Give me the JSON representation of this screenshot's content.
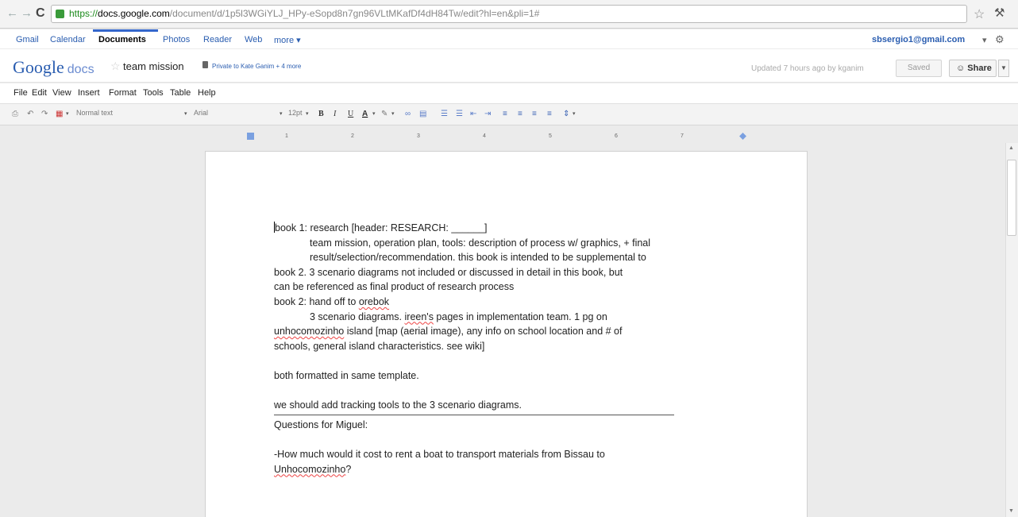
{
  "browser": {
    "url_https": "https://",
    "url_host": "docs.google.com",
    "url_path": "/document/d/1p5l3WGiYLJ_HPy-eSopd8n7gn96VLtMKafDf4dH84Tw/edit?hl=en&pli=1#"
  },
  "gbar": {
    "links": [
      "Gmail",
      "Calendar",
      "Documents",
      "Photos",
      "Reader",
      "Web",
      "more ▾"
    ],
    "account": "sbsergio1@gmail.com"
  },
  "header": {
    "logo": "Google",
    "logo_suffix": "docs",
    "title": "team mission",
    "privacy": "Private to Kate Ganim + 4 more",
    "updated": "Updated 7 hours ago by kganim",
    "saved": "Saved",
    "share": "Share"
  },
  "menu": [
    "File",
    "Edit",
    "View",
    "Insert",
    "Format",
    "Tools",
    "Table",
    "Help"
  ],
  "toolbar": {
    "style": "Normal text",
    "font": "Arial",
    "size": "12pt",
    "bold": "B",
    "italic": "I",
    "underline": "U",
    "text_color": "A"
  },
  "ruler_numbers": [
    "1",
    "2",
    "3",
    "4",
    "5",
    "6",
    "7"
  ],
  "document": {
    "l1": "book 1: research [header:  RESEARCH: ______]",
    "l2": "team mission, operation plan, tools: description of process w/ graphics, + final",
    "l3": "result/selection/recommendation. this book is intended to be supplemental to",
    "l4": "book 2. 3 scenario diagrams not included or discussed in detail in this book, but",
    "l5": "can be referenced as final product of research process",
    "l6a": "book 2: hand off to ",
    "l6b": "orebok",
    "l7a": "3 scenario diagrams. ",
    "l7b": "ireen's",
    "l7c": " pages in implementation team.  1 pg on",
    "l8a": "unhocomozinho",
    "l8b": " island [map (aerial image), any info on school location and # of",
    "l9": "schools, general island characteristics. see wiki]",
    "l10": "both formatted in same template.",
    "l11": "we should add tracking tools to the 3 scenario diagrams.",
    "l12": "Questions for Miguel:",
    "l13": "-How much would it cost to rent a boat to transport materials from Bissau to",
    "l14a": "Unhocomozinho",
    "l14b": "?"
  }
}
